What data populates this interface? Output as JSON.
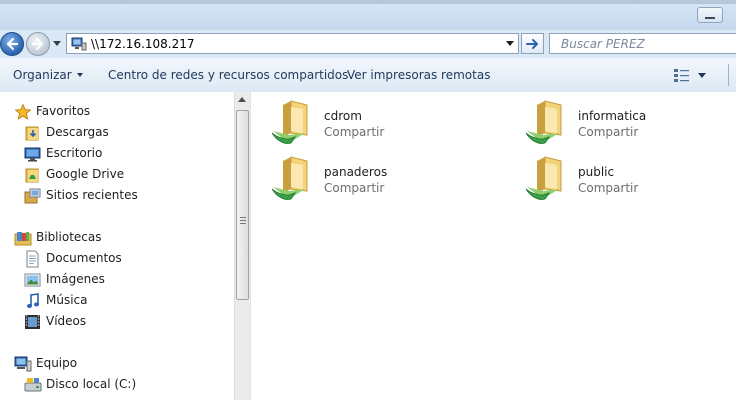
{
  "address": {
    "path": "\\\\172.16.108.217"
  },
  "search": {
    "placeholder": "Buscar PEREZ"
  },
  "toolbar": {
    "organize": "Organizar",
    "network_center": "Centro de redes y recursos compartidos",
    "view_printers": "Ver impresoras remotas"
  },
  "sidebar": {
    "favorites": {
      "header": "Favoritos",
      "items": [
        {
          "label": "Descargas",
          "icon": "downloads-folder-icon"
        },
        {
          "label": "Escritorio",
          "icon": "desktop-icon"
        },
        {
          "label": "Google Drive",
          "icon": "google-drive-folder-icon"
        },
        {
          "label": "Sitios recientes",
          "icon": "recent-places-icon"
        }
      ]
    },
    "libraries": {
      "header": "Bibliotecas",
      "items": [
        {
          "label": "Documentos",
          "icon": "documents-icon"
        },
        {
          "label": "Imágenes",
          "icon": "pictures-icon"
        },
        {
          "label": "Música",
          "icon": "music-icon"
        },
        {
          "label": "Vídeos",
          "icon": "videos-icon"
        }
      ]
    },
    "computer": {
      "header": "Equipo",
      "items": [
        {
          "label": "Disco local (C:)",
          "icon": "local-disk-icon"
        }
      ]
    }
  },
  "shares": [
    {
      "name": "cdrom",
      "type": "Compartir"
    },
    {
      "name": "informatica",
      "type": "Compartir"
    },
    {
      "name": "panaderos",
      "type": "Compartir"
    },
    {
      "name": "public",
      "type": "Compartir"
    }
  ],
  "colors": {
    "chrome_blue": "#dbe8f6",
    "toolbar_text": "#1e395b",
    "folder_yellow": "#e9c25a",
    "share_green": "#3aa046"
  }
}
